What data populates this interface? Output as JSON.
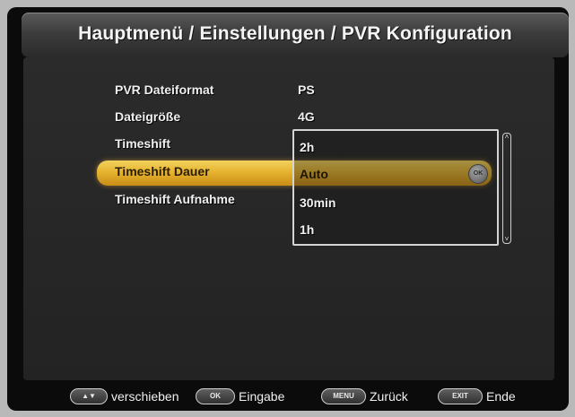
{
  "header": {
    "title": "Hauptmenü / Einstellungen / PVR Konfiguration"
  },
  "settings": [
    {
      "label": "PVR Dateiformat",
      "value": "PS"
    },
    {
      "label": "Dateigröße",
      "value": "4G"
    },
    {
      "label": "Timeshift",
      "value": "2h"
    },
    {
      "label": "Timeshift Dauer",
      "value": "Auto"
    },
    {
      "label": "Timeshift Aufnahme",
      "value": "30min"
    }
  ],
  "dropdown": {
    "options": [
      "2h",
      "Auto",
      "30min",
      "1h"
    ],
    "selected": "Auto"
  },
  "ok_icon": {
    "text": "OK",
    "icon": "ok-button-icon"
  },
  "footer": {
    "hints": [
      {
        "key": "▲▼",
        "label": "verschieben"
      },
      {
        "key": "OK",
        "label": "Eingabe"
      },
      {
        "key": "MENU",
        "label": "Zurück"
      },
      {
        "key": "EXIT",
        "label": "Ende"
      }
    ]
  },
  "colors": {
    "highlight": "#e6b430",
    "background": "#232323",
    "title_bar": "#3c3c3c"
  }
}
